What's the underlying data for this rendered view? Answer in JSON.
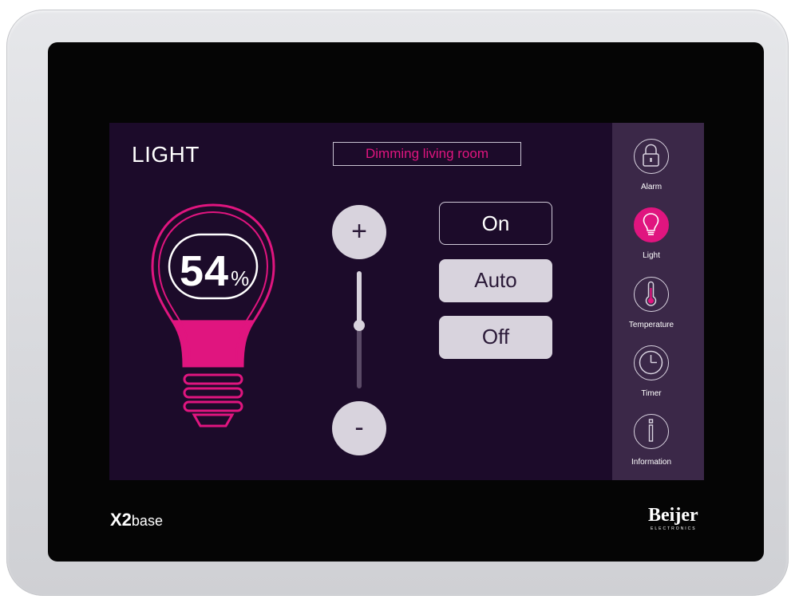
{
  "screen": {
    "title": "LIGHT",
    "room_label": "Dimming living room",
    "dimmer": {
      "percent_value": "54",
      "percent_unit": "%",
      "level": 0.54
    },
    "buttons": {
      "increase": "+",
      "decrease": "-"
    },
    "modes": [
      {
        "label": "On",
        "selected": true
      },
      {
        "label": "Auto",
        "selected": false
      },
      {
        "label": "Off",
        "selected": false
      }
    ],
    "nav": [
      {
        "label": "Alarm",
        "icon": "lock-icon",
        "active": false
      },
      {
        "label": "Light",
        "icon": "lightbulb-icon",
        "active": true
      },
      {
        "label": "Temperature",
        "icon": "thermometer-icon",
        "active": false
      },
      {
        "label": "Timer",
        "icon": "clock-icon",
        "active": false
      },
      {
        "label": "Information",
        "icon": "info-icon",
        "active": false
      }
    ]
  },
  "device": {
    "model_main": "X2",
    "model_sub": "base",
    "brand": "Beijer",
    "brand_sub": "ELECTRONICS"
  },
  "colors": {
    "accent": "#e0157f",
    "screen_bg": "#1c0b2a",
    "sidebar_bg": "#3b2848",
    "button_bg": "#d8d3dd"
  }
}
